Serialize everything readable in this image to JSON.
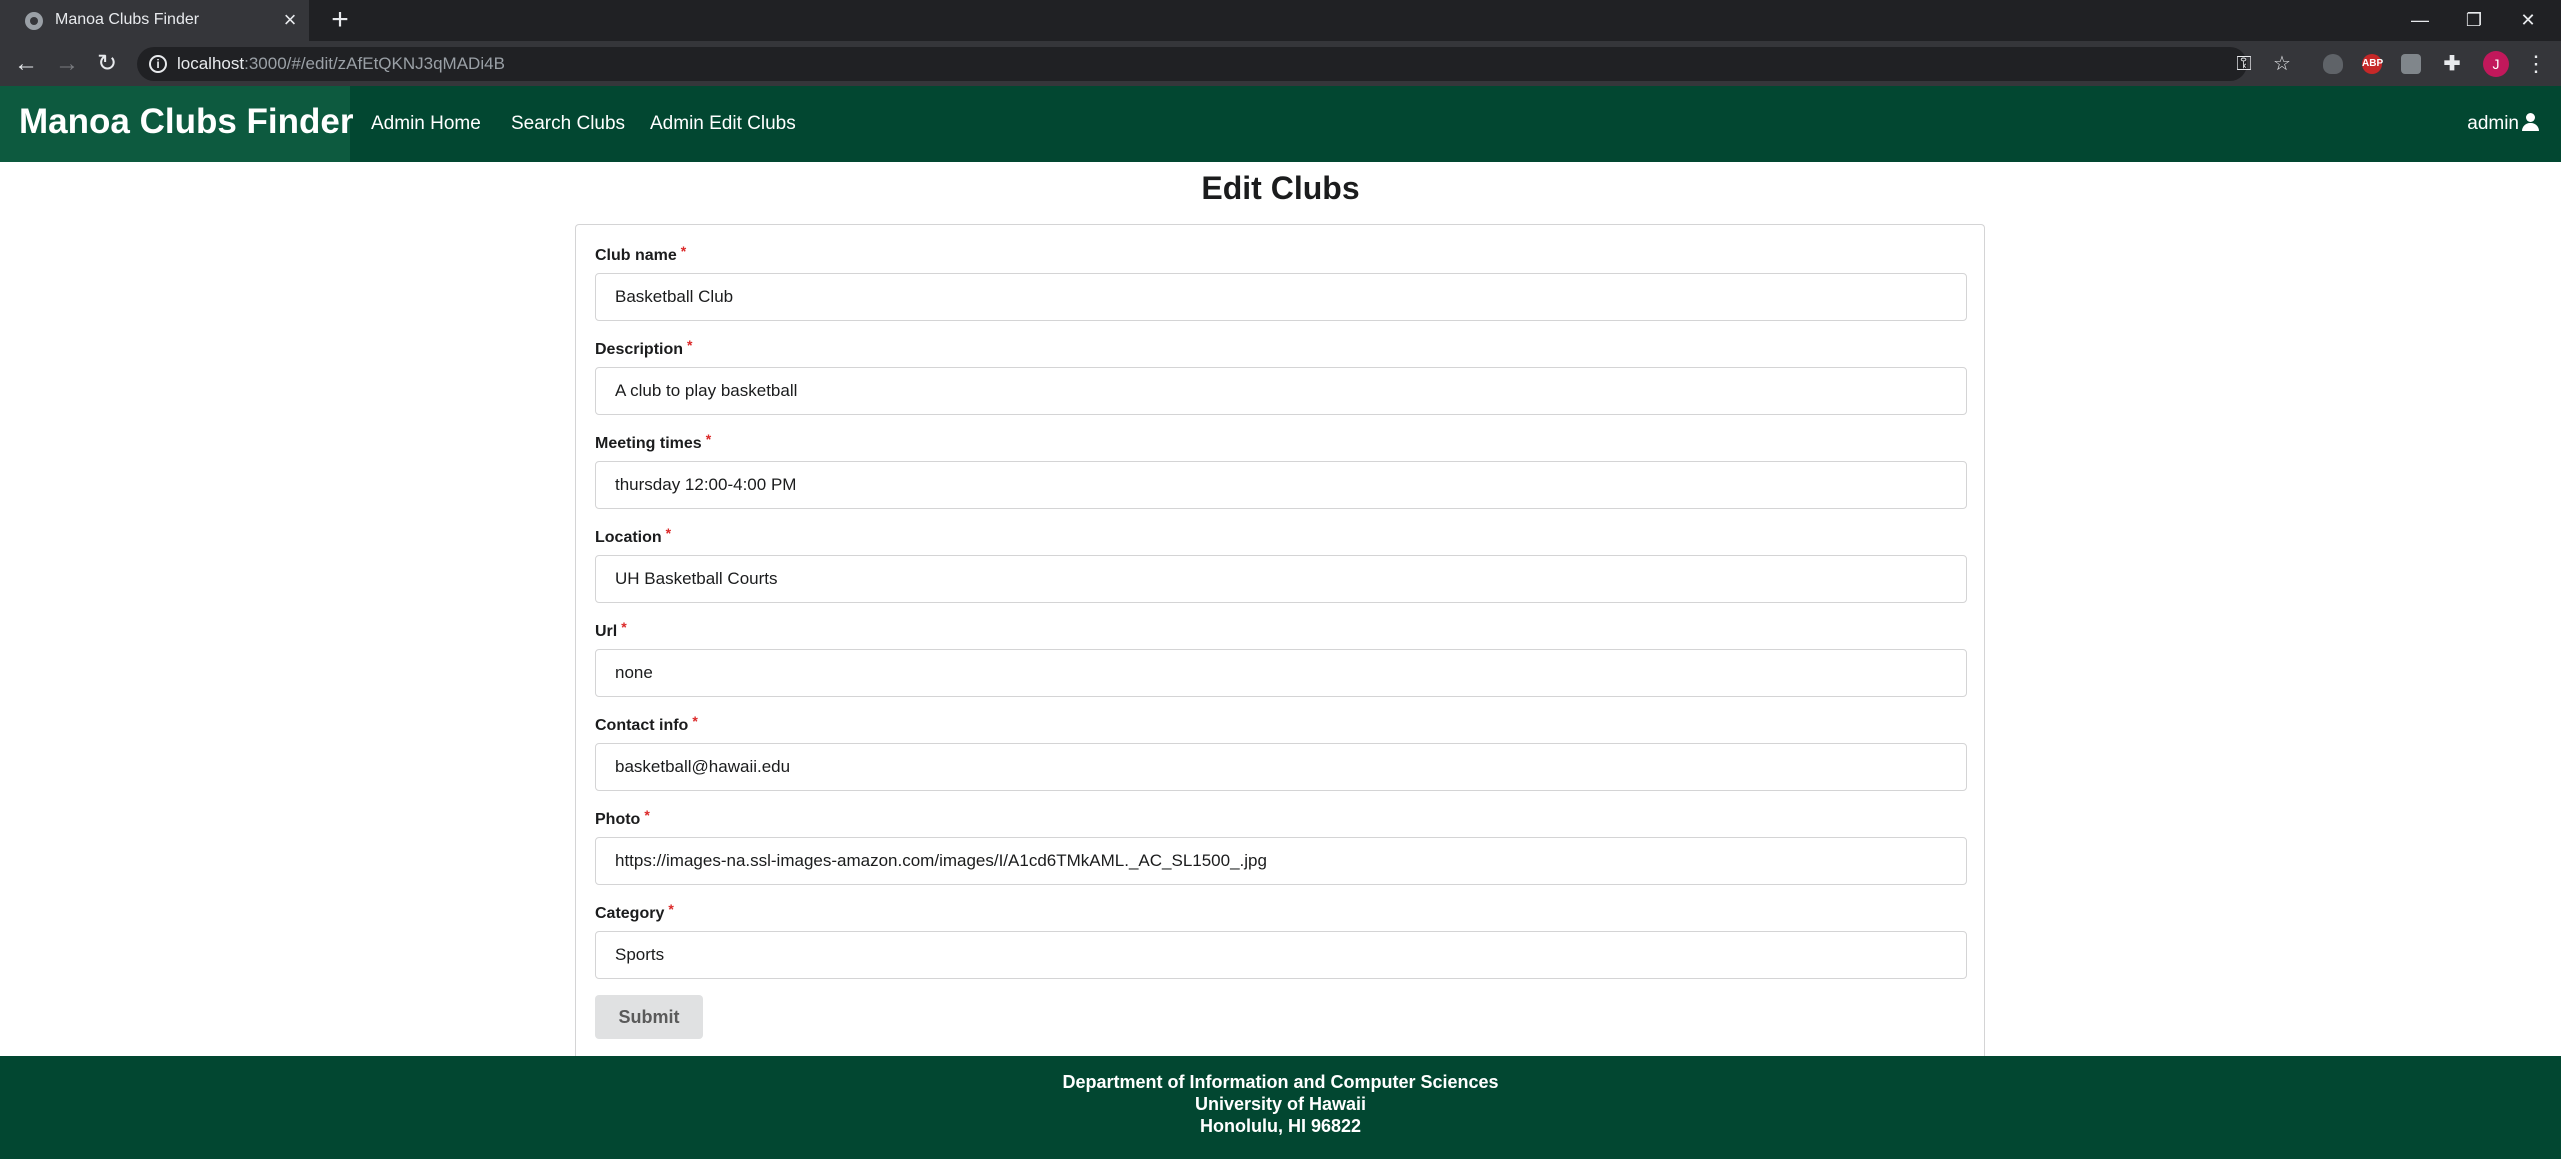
{
  "browser": {
    "tab_title": "Manoa Clubs Finder",
    "tab_close": "×",
    "new_tab": "+",
    "url_host": "localhost",
    "url_path": ":3000/#/edit/zAfEtQKNJ3qMADi4B",
    "window_controls": {
      "minimize": "—",
      "restore": "❐",
      "close": "✕"
    },
    "nav": {
      "back": "←",
      "forward": "→",
      "reload": "↻"
    },
    "extensions": {
      "adblock": "ABP"
    },
    "profile_initial": "J"
  },
  "navbar": {
    "brand": "Manoa Clubs Finder",
    "items": [
      {
        "label": "Admin Home"
      },
      {
        "label": "Search Clubs"
      },
      {
        "label": "Admin Edit Clubs"
      }
    ],
    "user": "admin"
  },
  "page": {
    "title": "Edit Clubs"
  },
  "form": {
    "fields": [
      {
        "label": "Club name",
        "value": "Basketball Club"
      },
      {
        "label": "Description",
        "value": "A club to play basketball"
      },
      {
        "label": "Meeting times",
        "value": "thursday 12:00-4:00 PM"
      },
      {
        "label": "Location",
        "value": "UH Basketball Courts"
      },
      {
        "label": "Url",
        "value": "none"
      },
      {
        "label": "Contact info",
        "value": "basketball@hawaii.edu"
      },
      {
        "label": "Photo",
        "value": "https://images-na.ssl-images-amazon.com/images/I/A1cd6TMkAML._AC_SL1500_.jpg"
      },
      {
        "label": "Category",
        "value": "Sports"
      }
    ],
    "required_marker": "*",
    "submit_label": "Submit"
  },
  "footer": {
    "lines": [
      "Department of Information and Computer Sciences",
      "University of Hawaii",
      "Honolulu, HI 96822"
    ]
  },
  "colors": {
    "navbar_bg": "#024731",
    "brand_bg": "#0d5a3f",
    "footer_bg": "#024731",
    "required": "#db2828",
    "submit_bg": "#e0e1e2"
  }
}
